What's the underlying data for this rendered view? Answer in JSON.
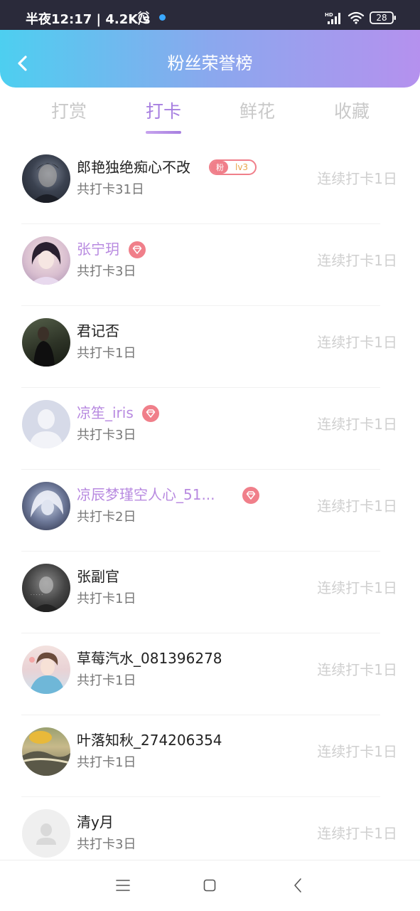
{
  "status_bar": {
    "time_speed": "半夜12:17 | 4.2K/s",
    "network": "HD",
    "battery": "28"
  },
  "header": {
    "title": "粉丝荣誉榜"
  },
  "tabs": [
    {
      "label": "打赏",
      "active": false
    },
    {
      "label": "打卡",
      "active": true
    },
    {
      "label": "鲜花",
      "active": false
    },
    {
      "label": "收藏",
      "active": false
    }
  ],
  "colors": {
    "accent": "#a77fe0",
    "vip_name": "#b88ae0",
    "badge": "#f07f8a",
    "header_gradient_start": "#4dcff0",
    "header_gradient_end": "#b591ee"
  },
  "fans": [
    {
      "name": "郎艳独绝痴心不改",
      "total": "共打卡31日",
      "streak": "连续打卡1日",
      "vip": false,
      "badge": "fan",
      "fan_badge_label": "粉",
      "fan_badge_level": "lv3",
      "avatar": "photo-dark-man"
    },
    {
      "name": "张宁玥",
      "total": "共打卡3日",
      "streak": "连续打卡1日",
      "vip": true,
      "badge": "diamond",
      "avatar": "photo-woman"
    },
    {
      "name": "君记否",
      "total": "共打卡1日",
      "streak": "连续打卡1日",
      "vip": false,
      "badge": "",
      "avatar": "photo-dark-figure"
    },
    {
      "name": "凉笙_iris",
      "total": "共打卡3日",
      "streak": "连续打卡1日",
      "vip": true,
      "badge": "diamond",
      "avatar": "default-avatar"
    },
    {
      "name": "凉辰梦瑾空人心_51...",
      "total": "共打卡2日",
      "streak": "连续打卡1日",
      "vip": true,
      "badge": "diamond",
      "avatar": "photo-white-hair"
    },
    {
      "name": "张副官",
      "total": "共打卡1日",
      "streak": "连续打卡1日",
      "vip": false,
      "badge": "",
      "avatar": "photo-grey"
    },
    {
      "name": "草莓汽水_081396278",
      "total": "共打卡1日",
      "streak": "连续打卡1日",
      "vip": false,
      "badge": "",
      "avatar": "photo-boy"
    },
    {
      "name": "叶落知秋_274206354",
      "total": "共打卡1日",
      "streak": "连续打卡1日",
      "vip": false,
      "badge": "",
      "avatar": "photo-landscape"
    },
    {
      "name": "清y月",
      "total": "共打卡3日",
      "streak": "连续打卡1日",
      "vip": false,
      "badge": "",
      "avatar": "default-avatar-light"
    }
  ]
}
